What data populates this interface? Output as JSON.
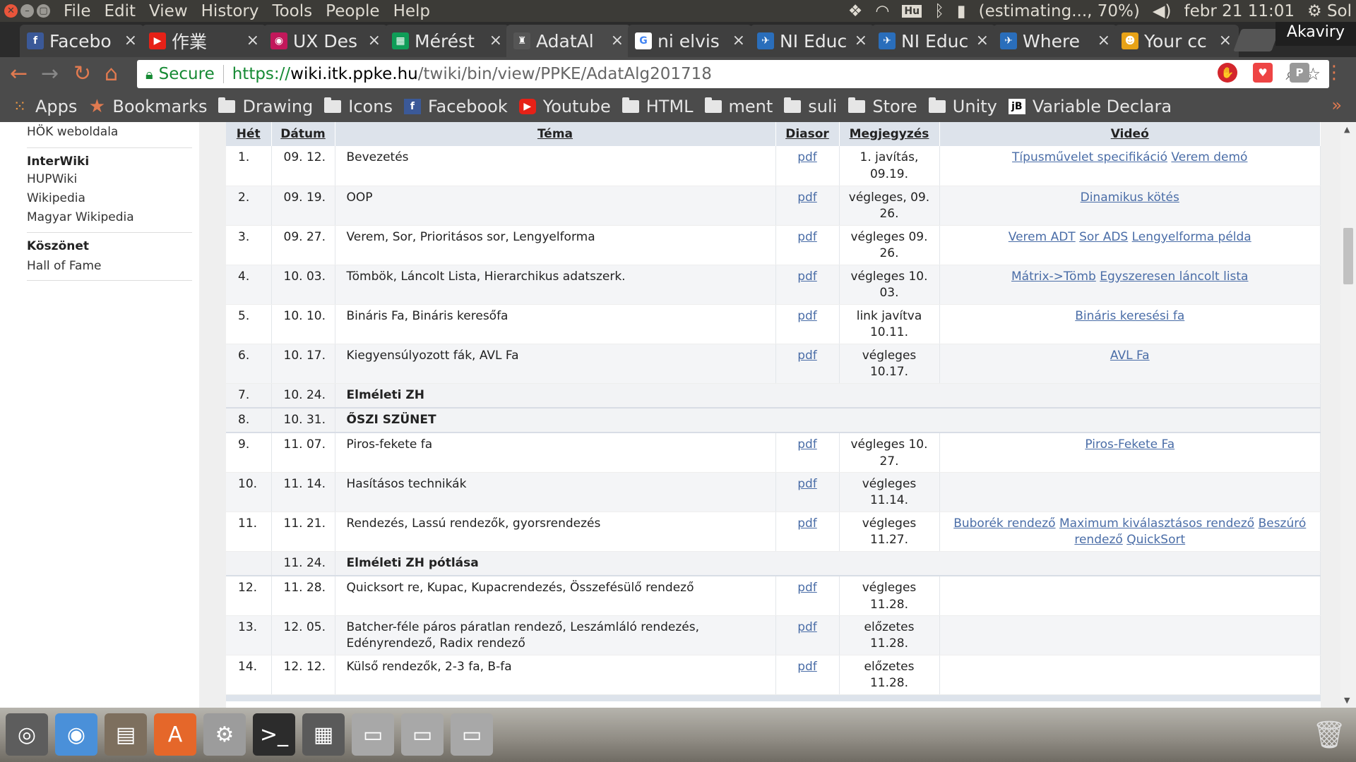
{
  "system": {
    "menu": [
      "File",
      "Edit",
      "View",
      "History",
      "Tools",
      "People",
      "Help"
    ],
    "battery": "(estimating..., 70%)",
    "datetime": "febr 21 11:01",
    "session": "Sol",
    "keyboard": "Hu"
  },
  "tabs": [
    {
      "label": "Facebo",
      "icon": "facebook-icon",
      "fav": "f",
      "color": "#3b5998"
    },
    {
      "label": "作業",
      "icon": "youtube-icon",
      "fav": "▶",
      "color": "#e62117"
    },
    {
      "label": "UX Des",
      "icon": "ux-icon",
      "fav": "◉",
      "color": "#c2185b"
    },
    {
      "label": "Mérést",
      "icon": "sheets-icon",
      "fav": "▦",
      "color": "#0f9d58"
    },
    {
      "label": "AdatAl",
      "icon": "wiki-icon",
      "fav": "♜",
      "color": "#555555"
    },
    {
      "label": "ni elvis",
      "icon": "google-icon",
      "fav": "G",
      "color": "#ffffff"
    },
    {
      "label": "NI Educ",
      "icon": "ni-icon",
      "fav": "✈",
      "color": "#2a6ebb"
    },
    {
      "label": "NI Educ",
      "icon": "ni-icon",
      "fav": "✈",
      "color": "#2a6ebb"
    },
    {
      "label": "Where",
      "icon": "ni-icon",
      "fav": "✈",
      "color": "#2a6ebb"
    },
    {
      "label": "Your cc",
      "icon": "yourcc-icon",
      "fav": "☻",
      "color": "#e8a317"
    }
  ],
  "profile_name": "Akaviry",
  "address": {
    "secure_label": "Secure",
    "url_prefix": "https://",
    "url_host": "wiki.itk.ppke.hu",
    "url_path": "/twiki/bin/view/PPKE/AdatAlg201718"
  },
  "bookmarks": {
    "apps": "Apps",
    "bookmarks": "Bookmarks",
    "items": [
      {
        "label": "Drawing",
        "icon": "folder-icon"
      },
      {
        "label": "Icons",
        "icon": "folder-icon"
      },
      {
        "label": "Facebook",
        "icon": "facebook-icon"
      },
      {
        "label": "Youtube",
        "icon": "youtube-icon"
      },
      {
        "label": "HTML",
        "icon": "folder-icon"
      },
      {
        "label": "ment",
        "icon": "folder-icon"
      },
      {
        "label": "suli",
        "icon": "folder-icon"
      },
      {
        "label": "Store",
        "icon": "folder-icon"
      },
      {
        "label": "Unity",
        "icon": "folder-icon"
      },
      {
        "label": "Variable Declara",
        "icon": "jb-icon"
      }
    ],
    "more": "»"
  },
  "sidebar": {
    "hok": "HÖK weboldala",
    "interwiki_title": "InterWiki",
    "interwiki": [
      "HUPWiki",
      "Wikipedia",
      "Magyar Wikipedia"
    ],
    "thanks_title": "Köszönet",
    "hall": "Hall of Fame"
  },
  "table": {
    "headers": [
      "Hét",
      "Dátum",
      "Téma",
      "Diasor",
      "Megjegyzés",
      "Videó"
    ],
    "rows": [
      {
        "het": "1.",
        "datum": "09. 12.",
        "tema": "Bevezetés",
        "diasor": "pdf",
        "megj": "1. javítás, 09.19.",
        "videok": [
          "Típusművelet specifikáció",
          "Verem demó"
        ]
      },
      {
        "het": "2.",
        "datum": "09. 19.",
        "tema": "OOP",
        "diasor": "pdf",
        "megj": "végleges, 09. 26.",
        "videok": [
          "Dinamikus kötés"
        ]
      },
      {
        "het": "3.",
        "datum": "09. 27.",
        "tema": "Verem, Sor, Prioritásos sor, Lengyelforma",
        "diasor": "pdf",
        "megj": "végleges 09. 26.",
        "videok": [
          "Verem ADT",
          "Sor ADS",
          "Lengyelforma példa"
        ]
      },
      {
        "het": "4.",
        "datum": "10. 03.",
        "tema": "Tömbök, Láncolt Lista, Hierarchikus adatszerk.",
        "diasor": "pdf",
        "megj": "végleges 10. 03.",
        "videok": [
          "Mátrix->Tömb",
          "Egyszeresen láncolt lista"
        ]
      },
      {
        "het": "5.",
        "datum": "10. 10.",
        "tema": "Bináris Fa, Bináris keresőfa",
        "diasor": "pdf",
        "megj": "link javítva 10.11.",
        "videok": [
          "Bináris keresési fa"
        ]
      },
      {
        "het": "6.",
        "datum": "10. 17.",
        "tema": "Kiegyensúlyozott fák, AVL Fa",
        "diasor": "pdf",
        "megj": "végleges 10.17.",
        "videok": [
          "AVL Fa"
        ]
      },
      {
        "het": "7.",
        "datum": "10. 24.",
        "tema": "Elméleti ZH",
        "band": true
      },
      {
        "het": "8.",
        "datum": "10. 31.",
        "tema": "ŐSZI SZÜNET",
        "band": true
      },
      {
        "het": "9.",
        "datum": "11. 07.",
        "tema": "Piros-fekete fa",
        "diasor": "pdf",
        "megj": "végleges 10. 27.",
        "videok": [
          "Piros-Fekete Fa"
        ]
      },
      {
        "het": "10.",
        "datum": "11. 14.",
        "tema": "Hasításos technikák",
        "diasor": "pdf",
        "megj": "végleges 11.14.",
        "videok": []
      },
      {
        "het": "11.",
        "datum": "11. 21.",
        "tema": "Rendezés, Lassú rendezők, gyorsrendezés",
        "diasor": "pdf",
        "megj": "végleges 11.27.",
        "videok": [
          "Buborék rendező",
          "Maximum kiválasztásos rendező",
          "Beszúró rendező",
          "QuickSort"
        ]
      },
      {
        "het": "",
        "datum": "11. 24.",
        "tema": "Elméleti ZH pótlása",
        "band": true
      },
      {
        "het": "12.",
        "datum": "11. 28.",
        "tema": "Quicksort re, Kupac, Kupacrendezés, Összefésülő rendező",
        "diasor": "pdf",
        "megj": "végleges 11.28.",
        "videok": []
      },
      {
        "het": "13.",
        "datum": "12. 05.",
        "tema": "Batcher-féle páros páratlan rendező, Leszámláló rendezés, Edényrendező, Radix rendező",
        "diasor": "pdf",
        "megj": "előzetes 11.28.",
        "videok": []
      },
      {
        "het": "14.",
        "datum": "12. 12.",
        "tema": "Külső rendezők, 2-3 fa, B-fa",
        "diasor": "pdf",
        "megj": "előzetes 11.28.",
        "videok": []
      }
    ]
  },
  "dock": [
    {
      "name": "ubuntu-icon",
      "glyph": "◎",
      "bg": "#5d5d5d"
    },
    {
      "name": "chrome-icon",
      "glyph": "◉",
      "bg": "#4a90d9"
    },
    {
      "name": "files-icon",
      "glyph": "▤",
      "bg": "#7d6f5e"
    },
    {
      "name": "software-center-icon",
      "glyph": "A",
      "bg": "#e5672a"
    },
    {
      "name": "settings-icon",
      "glyph": "⚙",
      "bg": "#9c9c9c"
    },
    {
      "name": "terminal-icon",
      "glyph": ">_",
      "bg": "#2c2c2c"
    },
    {
      "name": "calculator-icon",
      "glyph": "▦",
      "bg": "#5a5a5a"
    },
    {
      "name": "drive-icon",
      "glyph": "▭",
      "bg": "#a8a8a8"
    },
    {
      "name": "drive-icon",
      "glyph": "▭",
      "bg": "#a8a8a8"
    },
    {
      "name": "drive-icon",
      "glyph": "▭",
      "bg": "#a8a8a8"
    }
  ],
  "colors": {
    "link": "#4a6da7",
    "header_bg": "#dde3eb",
    "accent": "#e07a50"
  }
}
